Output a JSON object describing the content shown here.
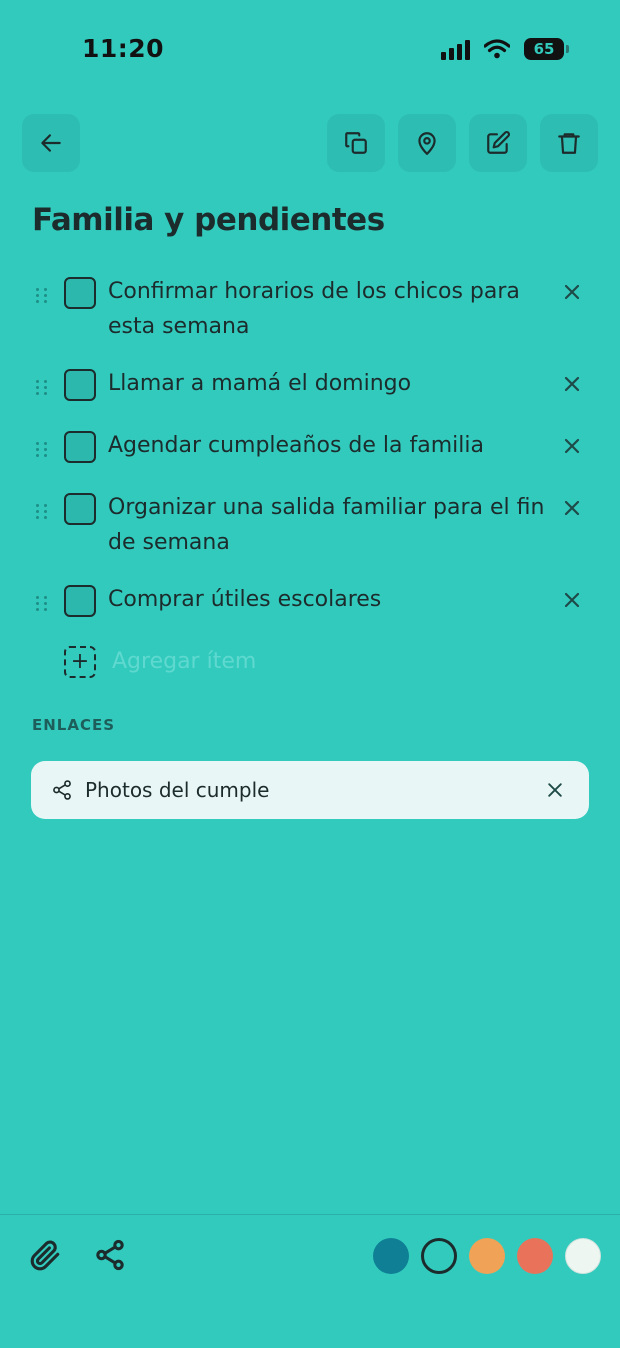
{
  "status": {
    "time": "11:20",
    "battery": "65"
  },
  "toolbar": {
    "back_icon": "arrow-left-icon",
    "copy_icon": "copy-icon",
    "location_icon": "map-pin-icon",
    "edit_icon": "edit-icon",
    "delete_icon": "trash-icon"
  },
  "note": {
    "title": "Familia y pendientes"
  },
  "checklist": {
    "items": [
      {
        "text": "Confirmar horarios de los chicos para esta semana",
        "checked": false
      },
      {
        "text": "Llamar a mamá el domingo",
        "checked": false
      },
      {
        "text": "Agendar cumpleaños de la familia",
        "checked": false
      },
      {
        "text": "Organizar una salida familiar para el fin de semana",
        "checked": false
      },
      {
        "text": "Comprar útiles escolares",
        "checked": false
      }
    ],
    "add_placeholder": "Agregar ítem"
  },
  "links": {
    "section_label": "ENLACES",
    "items": [
      {
        "text": "Photos del cumple"
      }
    ]
  },
  "bottom_bar": {
    "attach_icon": "paperclip-icon",
    "share_icon": "share-icon",
    "colors": [
      "#0E7F94",
      "#33CABE",
      "#F0A356",
      "#E8735A",
      "#EEF6F1"
    ],
    "selected_color_index": 1
  }
}
